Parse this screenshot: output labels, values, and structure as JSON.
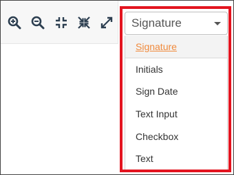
{
  "toolbar": {
    "tools": [
      {
        "name": "zoom-in",
        "icon": "zoom-in-icon"
      },
      {
        "name": "zoom-out",
        "icon": "zoom-out-icon"
      },
      {
        "name": "fit-page",
        "icon": "collapse-arrows-icon"
      },
      {
        "name": "fit-width",
        "icon": "compress-arrows-icon"
      },
      {
        "name": "fullscreen",
        "icon": "expand-arrows-icon"
      }
    ],
    "icon_color": "#2c3e50"
  },
  "field_type_select": {
    "selected_value": "Signature",
    "options": [
      "Signature",
      "Initials",
      "Sign Date",
      "Text Input",
      "Checkbox",
      "Text"
    ],
    "selected_index": 0,
    "selected_color": "#f08a3c"
  },
  "highlight_color": "#e3141f"
}
